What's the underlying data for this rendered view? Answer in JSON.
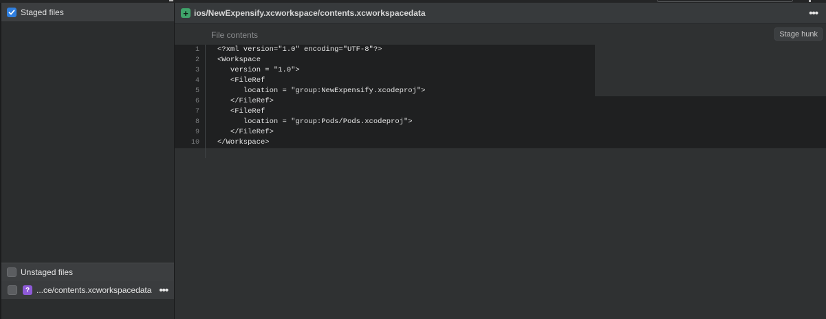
{
  "sidebar": {
    "staged": {
      "label": "Staged files",
      "checked": true
    },
    "unstaged": {
      "label": "Unstaged files",
      "checked": false,
      "files": [
        {
          "name": "...ce/contents.xcworkspacedata",
          "status": "?",
          "status_color": "#8e5ad8",
          "more": "•••"
        }
      ]
    }
  },
  "main": {
    "file_header": {
      "status_icon": "+",
      "status_color": "#3fa46a",
      "path": "ios/NewExpensify.xcworkspace/contents.xcworkspacedata",
      "more": "•••"
    },
    "hunk": {
      "label": "File contents",
      "stage_button": "Stage hunk",
      "lines": [
        {
          "n": "1",
          "text": "<?xml version=\"1.0\" encoding=\"UTF-8\"?>"
        },
        {
          "n": "2",
          "text": "<Workspace"
        },
        {
          "n": "3",
          "text": "   version = \"1.0\">"
        },
        {
          "n": "4",
          "text": "   <FileRef"
        },
        {
          "n": "5",
          "text": "      location = \"group:NewExpensify.xcodeproj\">"
        },
        {
          "n": "6",
          "text": "   </FileRef>"
        },
        {
          "n": "7",
          "text": "   <FileRef"
        },
        {
          "n": "8",
          "text": "      location = \"group:Pods/Pods.xcodeproj\">"
        },
        {
          "n": "9",
          "text": "   </FileRef>"
        },
        {
          "n": "10",
          "text": "</Workspace>"
        }
      ]
    }
  },
  "colors": {
    "accent_checkbox": "#2f7fe0",
    "code_background": "#1f2021",
    "panel_background": "#2f3132"
  }
}
